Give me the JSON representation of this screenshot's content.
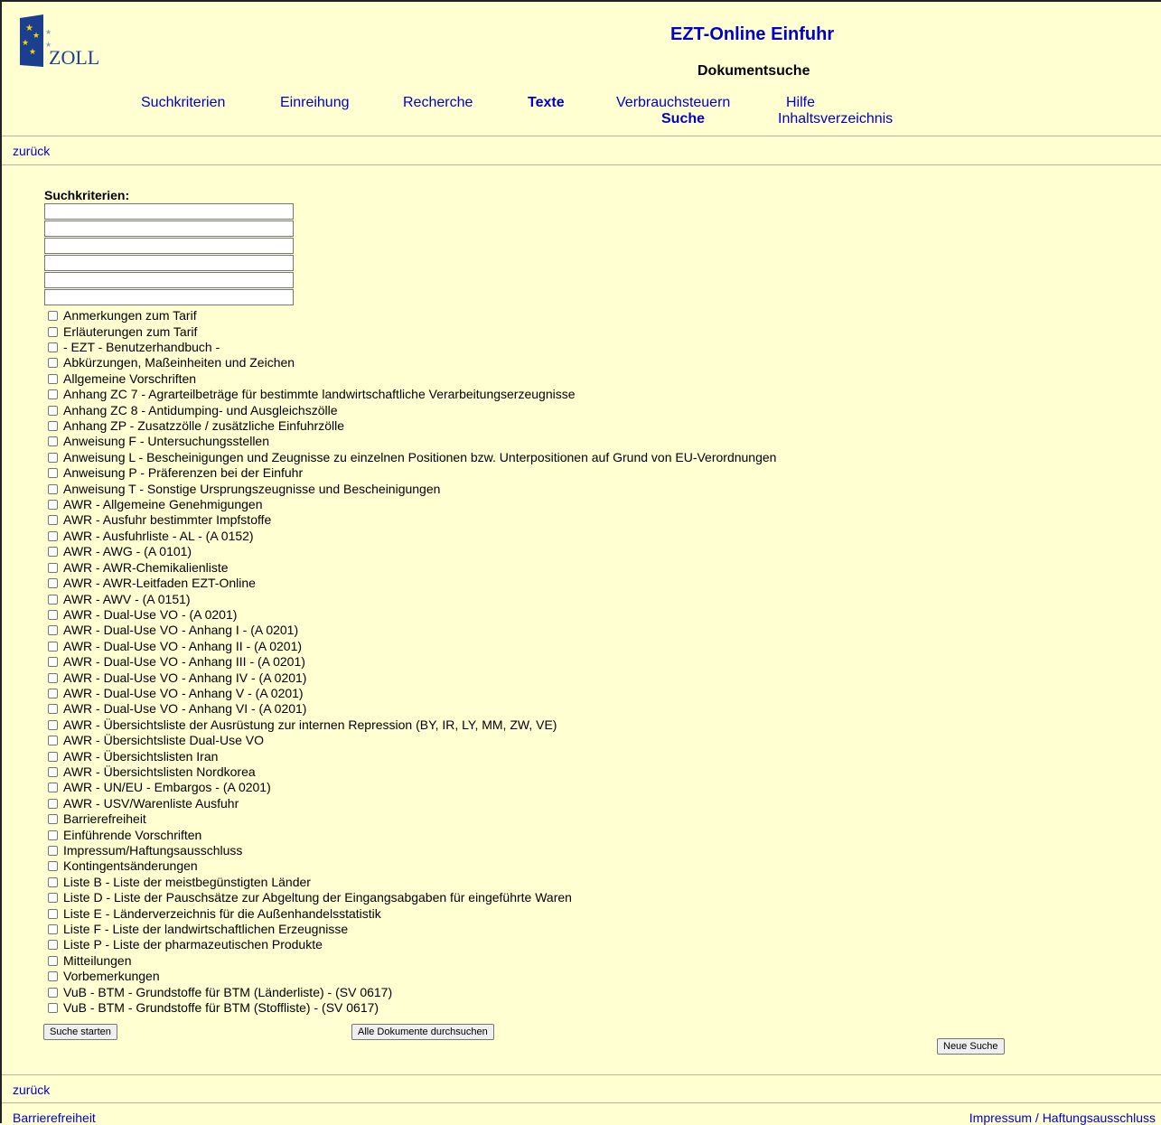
{
  "header": {
    "logo_text": "ZOLL",
    "app_title": "EZT-Online Einfuhr",
    "subtitle": "Dokumentsuche"
  },
  "nav": {
    "suchkriterien": "Suchkriterien",
    "einreihung": "Einreihung",
    "recherche": "Recherche",
    "texte": "Texte",
    "verbrauchsteuern": "Verbrauchsteuern",
    "suche": "Suche",
    "hilfe": "Hilfe",
    "inhaltsverzeichnis": "Inhaltsverzeichnis"
  },
  "back_link": "zurück",
  "form": {
    "label": "Suchkriterien:",
    "inputs": [
      "",
      "",
      "",
      "",
      "",
      ""
    ],
    "checkboxes": [
      "Anmerkungen zum Tarif",
      "Erläuterungen zum Tarif",
      "- EZT - Benutzerhandbuch -",
      "Abkürzungen, Maßeinheiten und Zeichen",
      "Allgemeine Vorschriften",
      "Anhang ZC 7 - Agrarteilbeträge für bestimmte landwirtschaftliche Verarbeitungserzeugnisse",
      "Anhang ZC 8 - Antidumping- und Ausgleichszölle",
      "Anhang ZP - Zusatzzölle / zusätzliche Einfuhrzölle",
      "Anweisung F - Untersuchungsstellen",
      "Anweisung L - Bescheinigungen und Zeugnisse zu einzelnen Positionen bzw. Unterpositionen auf Grund von EU-Verordnungen",
      "Anweisung P - Präferenzen bei der Einfuhr",
      "Anweisung T - Sonstige Ursprungszeugnisse und Bescheinigungen",
      "AWR - Allgemeine Genehmigungen",
      "AWR - Ausfuhr bestimmter Impfstoffe",
      "AWR - Ausfuhrliste - AL - (A 0152)",
      "AWR - AWG - (A 0101)",
      "AWR - AWR-Chemikalienliste",
      "AWR - AWR-Leitfaden EZT-Online",
      "AWR - AWV - (A 0151)",
      "AWR - Dual-Use VO - (A 0201)",
      "AWR - Dual-Use VO - Anhang I - (A 0201)",
      "AWR - Dual-Use VO - Anhang II - (A 0201)",
      "AWR - Dual-Use VO - Anhang III - (A 0201)",
      "AWR - Dual-Use VO - Anhang IV - (A 0201)",
      "AWR - Dual-Use VO - Anhang V - (A 0201)",
      "AWR - Dual-Use VO - Anhang VI - (A 0201)",
      "AWR - Übersichtsliste der Ausrüstung zur internen Repression (BY, IR, LY, MM, ZW, VE)",
      "AWR - Übersichtsliste Dual-Use VO",
      "AWR - Übersichtslisten Iran",
      "AWR - Übersichtslisten Nordkorea",
      "AWR - UN/EU - Embargos - (A 0201)",
      "AWR - USV/Warenliste Ausfuhr",
      "Barrierefreiheit",
      "Einführende Vorschriften",
      "Impressum/Haftungsausschluss",
      "Kontingentsänderungen",
      "Liste B - Liste der meistbegünstigten Länder",
      "Liste D - Liste der Pauschsätze zur Abgeltung der Eingangsabgaben für eingeführte Waren",
      "Liste E - Länderverzeichnis für die Außenhandelsstatistik",
      "Liste F - Liste der landwirtschaftlichen Erzeugnisse",
      "Liste P - Liste der pharmazeutischen Produkte",
      "Mitteilungen",
      "Vorbemerkungen",
      "VuB - BTM - Grundstoffe für BTM (Länderliste) - (SV 0617)",
      "VuB - BTM - Grundstoffe für BTM (Stoffliste) - (SV 0617)"
    ],
    "start_button": "Suche starten",
    "all_docs_button": "Alle Dokumente durchsuchen",
    "new_search_button": "Neue Suche"
  },
  "footer": {
    "accessibility": "Barrierefreiheit",
    "imprint": "Impressum / Haftungsausschluss"
  },
  "colors": {
    "background": "#ffffd1",
    "link": "#0000cc",
    "logo_blue": "#1b3f8f"
  }
}
